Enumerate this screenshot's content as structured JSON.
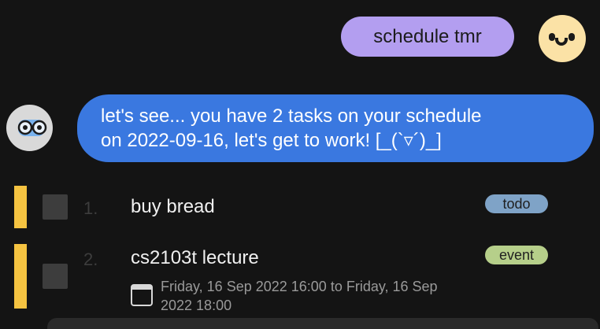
{
  "user_message": {
    "text": "schedule tmr",
    "bubble_color": "#b39ef0"
  },
  "user_avatar": {
    "icon": "smiley-face-icon",
    "color": "#fbe2a6"
  },
  "bot_avatar": {
    "icon": "glasses-bot-icon",
    "color": "#d9d9d9"
  },
  "bot_message": {
    "line1": "let's see... you have 2 tasks on your schedule",
    "line2": "on 2022-09-16, let's get to work! [_(`▿´)_]",
    "bubble_color": "#3a78e0"
  },
  "tasks": [
    {
      "index": "1.",
      "description": "buy bread",
      "tag": "todo",
      "tag_color": "#7fa3c7",
      "checked": false
    },
    {
      "index": "2.",
      "description": "cs2103t lecture",
      "tag": "event",
      "tag_color": "#b6cf8a",
      "checked": false,
      "date_line1": "Friday, 16 Sep 2022 16:00 to Friday, 16 Sep",
      "date_line2": "2022 18:00"
    }
  ],
  "accent_bar_color": "#f5c341"
}
